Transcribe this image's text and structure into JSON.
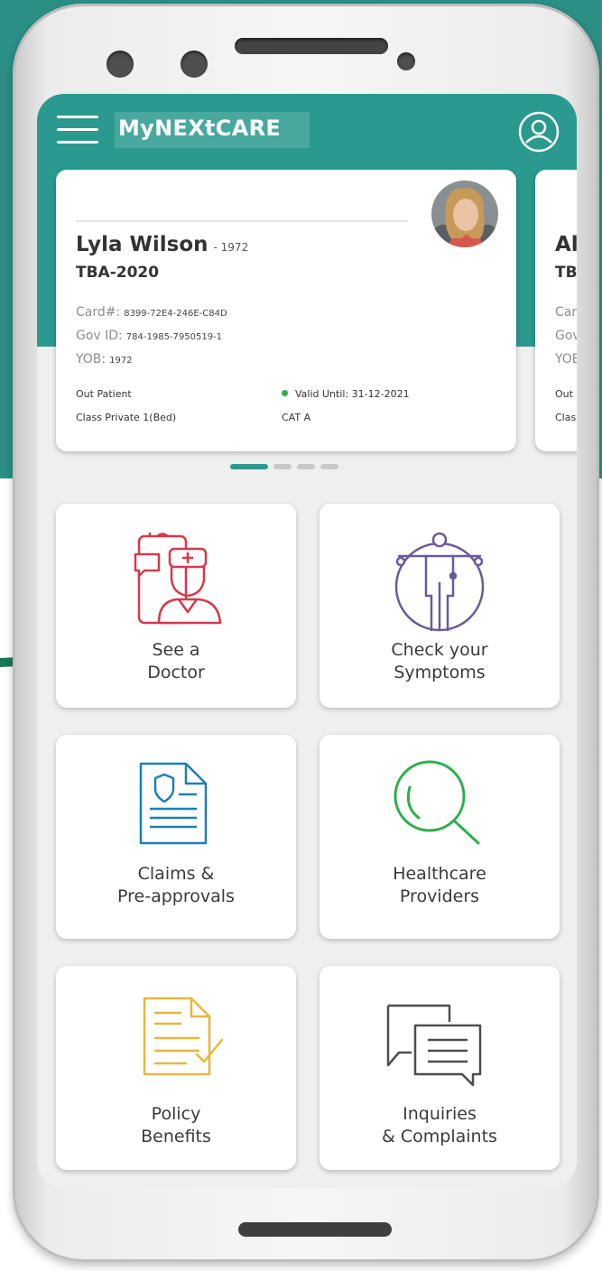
{
  "app": {
    "title": "MyNEXtCARE"
  },
  "card": {
    "name": "Lyla Wilson",
    "name_year": "- 1972",
    "plan": "TBA-2020",
    "card_label": "Card#:",
    "card_value": "8399-72E4-246E-C84D",
    "gov_label": "Gov ID:",
    "gov_value": "784-1985-7950519-1",
    "yob_label": "YOB:",
    "yob_value": "1972",
    "patient_type": "Out Patient",
    "valid_until": "Valid Until: 31-12-2021",
    "class": "Class Private 1(Bed)",
    "category": "CAT A"
  },
  "next_card": {
    "name": "Al",
    "plan": "TBA",
    "card_label": "Car",
    "gov_label": "Gov",
    "yob_label": "YOB",
    "patient_type": "Out P",
    "class": "Class"
  },
  "pager": {
    "active_index": 0,
    "count": 4
  },
  "tiles": {
    "see_doctor": {
      "line1": "See a",
      "line2": "Doctor"
    },
    "check_symptoms": {
      "line1": "Check your",
      "line2": "Symptoms"
    },
    "claims": {
      "line1": "Claims &",
      "line2": "Pre-approvals"
    },
    "providers": {
      "line1": "Healthcare",
      "line2": "Providers"
    },
    "policy": {
      "line1": "Policy",
      "line2": "Benefits"
    },
    "inquiries": {
      "line1": "Inquiries",
      "line2": "& Complaints"
    }
  },
  "icons": {
    "menu": "hamburger-menu-icon",
    "profile": "user-profile-icon",
    "see_doctor": "doctor-chat-icon",
    "check_symptoms": "body-symptoms-icon",
    "claims": "shield-document-icon",
    "providers": "magnifier-search-icon",
    "policy": "document-check-icon",
    "inquiries": "chat-bubbles-icon"
  },
  "colors": {
    "brand_teal": "#2b9a8e",
    "outer_teal": "#2b8f86",
    "doctor_red": "#d23a4b",
    "symptoms_purple": "#6b5a9a",
    "claims_blue": "#1d7fb5",
    "providers_green": "#2fae4e",
    "policy_yellow": "#e6b73a",
    "inquiries_gray": "#4d4d4d",
    "valid_green": "#2db24a"
  }
}
